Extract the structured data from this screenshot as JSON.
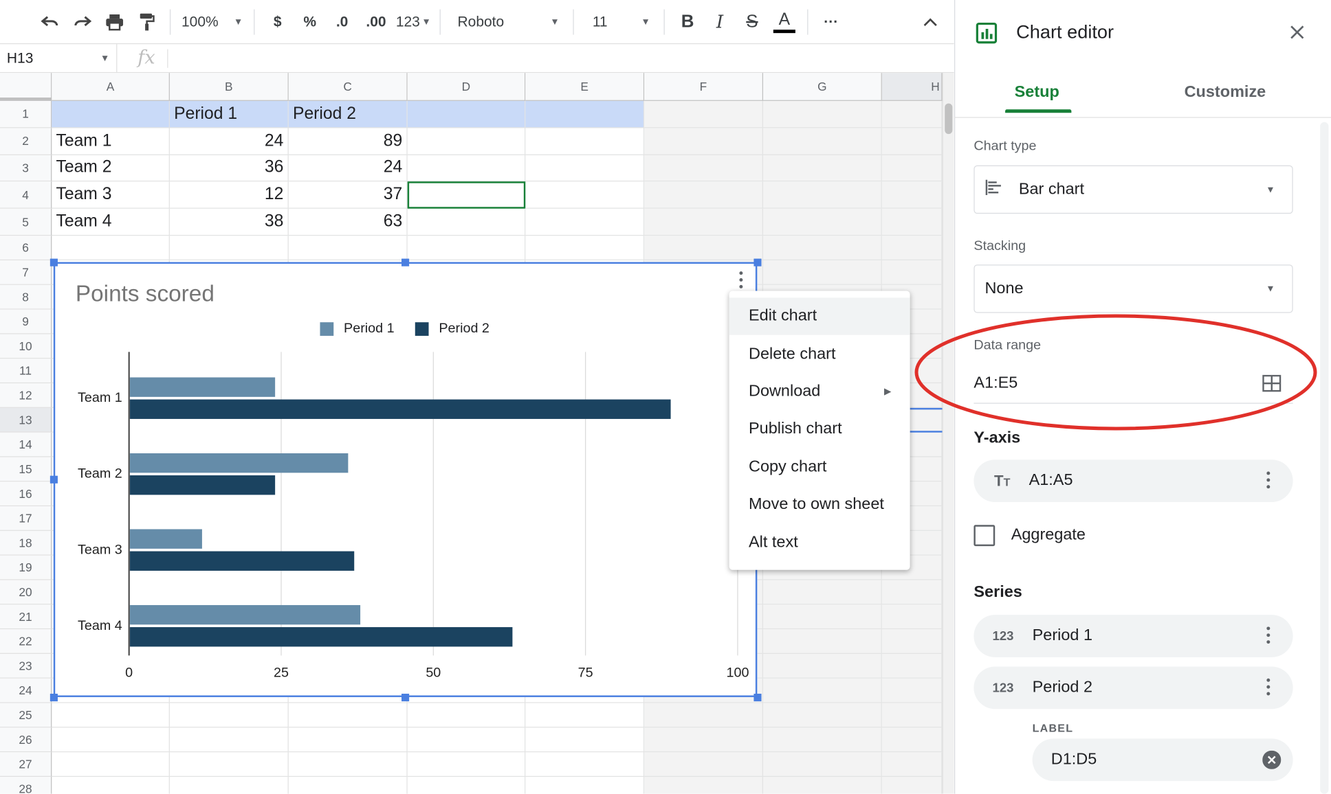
{
  "toolbar": {
    "zoom": "100%",
    "currency": "$",
    "percent": "%",
    "dec_decrease": ".0",
    "dec_increase": ".00",
    "more_formats": "123",
    "font": "Roboto",
    "font_size": "11",
    "bold": "B",
    "italic": "I",
    "strike": "S",
    "text_color": "A",
    "more": "···"
  },
  "formula_bar": {
    "name_box": "H13",
    "fx": "fx"
  },
  "columns": [
    "A",
    "B",
    "C",
    "D",
    "E",
    "F",
    "G",
    "H"
  ],
  "rows": [
    "1",
    "2",
    "3",
    "4",
    "5",
    "6",
    "7",
    "8",
    "9",
    "10",
    "11",
    "12",
    "13",
    "14",
    "15",
    "16",
    "17",
    "18",
    "19",
    "20",
    "21",
    "22",
    "23",
    "24",
    "25",
    "26",
    "27",
    "28"
  ],
  "cells": {
    "b1": "Period 1",
    "c1": "Period 2",
    "a2": "Team 1",
    "b2": "24",
    "c2": "89",
    "a3": "Team 2",
    "b3": "36",
    "c3": "24",
    "a4": "Team 3",
    "b4": "12",
    "c4": "37",
    "a5": "Team 4",
    "b5": "38",
    "c5": "63"
  },
  "chart_data": {
    "type": "bar",
    "orientation": "horizontal",
    "title": "Points scored",
    "categories": [
      "Team 1",
      "Team 2",
      "Team 3",
      "Team 4"
    ],
    "series": [
      {
        "name": "Period 1",
        "values": [
          24,
          36,
          12,
          38
        ],
        "color": "#658ca9"
      },
      {
        "name": "Period 2",
        "values": [
          89,
          24,
          37,
          63
        ],
        "color": "#1b4360"
      }
    ],
    "xlim": [
      0,
      100
    ],
    "x_ticks": [
      "0",
      "25",
      "50",
      "75",
      "100"
    ],
    "grid": true,
    "legend": "top"
  },
  "context_menu": {
    "items": [
      "Edit chart",
      "Delete chart",
      "Download",
      "Publish chart",
      "Copy chart",
      "Move to own sheet",
      "Alt text"
    ]
  },
  "chart_editor": {
    "title": "Chart editor",
    "tabs": [
      "Setup",
      "Customize"
    ],
    "chart_type_label": "Chart type",
    "chart_type_value": "Bar chart",
    "stacking_label": "Stacking",
    "stacking_value": "None",
    "data_range_label": "Data range",
    "data_range_value": "A1:E5",
    "y_axis_heading": "Y-axis",
    "y_axis_value": "A1:A5",
    "aggregate_label": "Aggregate",
    "series_heading": "Series",
    "series": [
      "Period 1",
      "Period 2"
    ],
    "series_icon_text": "123",
    "label_caption": "LABEL",
    "label_value": "D1:D5"
  },
  "colors": {
    "accent_green": "#188038",
    "selection_blue": "#4a7fe0",
    "annotation_red": "#e0302a",
    "header_highlight": "#c9daf8"
  }
}
